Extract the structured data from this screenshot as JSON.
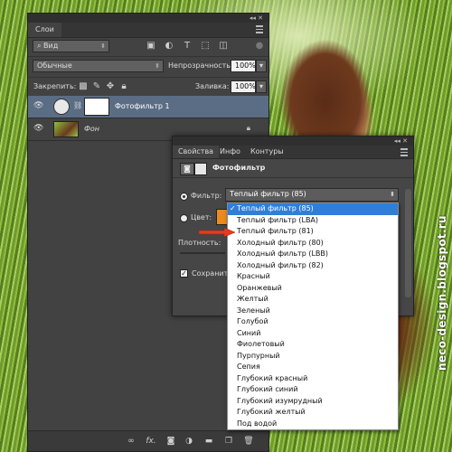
{
  "colors": {
    "panel": "#424242",
    "panel_dark": "#2f2f2f",
    "selection": "#2f7fd8",
    "layer_selected": "#5b6d85",
    "arrow": "#e53a1f"
  },
  "layers_panel": {
    "tab": "Слои",
    "filter": "Вид",
    "blend_mode": "Обычные",
    "opacity_label": "Непрозрачность:",
    "opacity_value": "100%",
    "lock_label": "Закрепить:",
    "fill_label": "Заливка:",
    "fill_value": "100%",
    "layers": [
      {
        "name": "Фотофильтр 1",
        "selected": true
      },
      {
        "name": "Фон",
        "selected": false
      }
    ],
    "footer_icons": [
      "link-icon",
      "fx-icon",
      "mask-icon",
      "adjustment-icon",
      "folder-icon",
      "new-layer-icon",
      "trash-icon"
    ]
  },
  "properties_panel": {
    "tabs": [
      "Свойства",
      "Инфо",
      "Контуры"
    ],
    "title": "Фотофильтр",
    "filter_label": "Фильтр:",
    "filter_value": "Теплый фильтр (85)",
    "color_label": "Цвет:",
    "density_label": "Плотность:",
    "preserve_label": "Сохранить"
  },
  "filter_dropdown": {
    "selected_index": 0,
    "options": [
      "Теплый фильтр (85)",
      "Теплый фильтр (LBA)",
      "Теплый фильтр (81)",
      "Холодный фильтр (80)",
      "Холодный фильтр (LBB)",
      "Холодный фильтр (82)",
      "Красный",
      "Оранжевый",
      "Желтый",
      "Зеленый",
      "Голубой",
      "Синий",
      "Фиолетовый",
      "Пурпурный",
      "Сепия",
      "Глубокий красный",
      "Глубокий синий",
      "Глубокий изумрудный",
      "Глубокий желтый",
      "Под водой"
    ]
  },
  "watermark": "neco-design.blogspot.ru"
}
